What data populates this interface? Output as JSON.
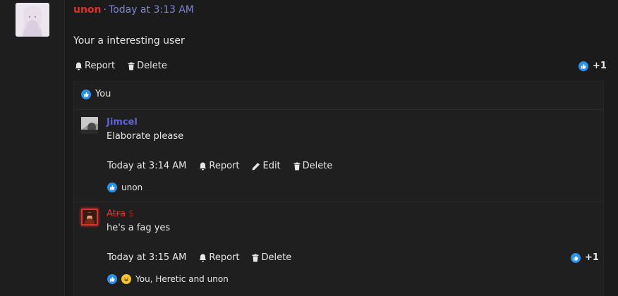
{
  "post": {
    "author": "unon",
    "separator": "·",
    "time": "Today at 3:13 AM",
    "body": "Your a interesting user",
    "actions": {
      "report": "Report",
      "delete": "Delete"
    },
    "reaction_count": "+1",
    "reacted_by": "You"
  },
  "comments": [
    {
      "author": "Jimcel",
      "text": "Elaborate please",
      "time": "Today at 3:14 AM",
      "actions": {
        "report": "Report",
        "edit": "Edit",
        "delete": "Delete"
      },
      "reacted_by": "unon"
    },
    {
      "author": "Atra",
      "badge": "$",
      "text": "he's a fag yes",
      "time": "Today at 3:15 AM",
      "actions": {
        "report": "Report",
        "delete": "Delete"
      },
      "reaction_count": "+1",
      "reacted_by": "You, Heretic and unon"
    }
  ],
  "colors": {
    "author_red": "#e0302a",
    "author_blue": "#5b63d6",
    "time_link": "#7f86d0",
    "like": "#2c8fe8"
  }
}
